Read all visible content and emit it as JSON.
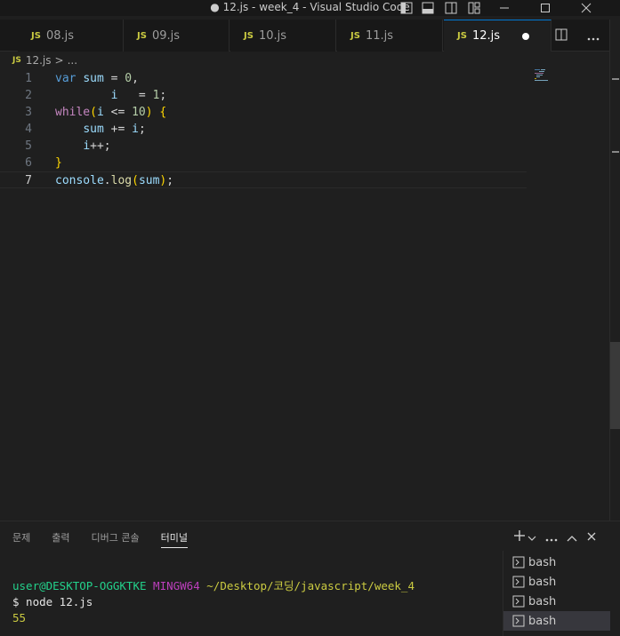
{
  "window": {
    "title": "● 12.js - week_4 - Visual Studio Code"
  },
  "tabs": [
    {
      "badge": "JS",
      "label": "08.js"
    },
    {
      "badge": "JS",
      "label": "09.js"
    },
    {
      "badge": "JS",
      "label": "10.js"
    },
    {
      "badge": "JS",
      "label": "11.js"
    },
    {
      "badge": "JS",
      "label": "12.js"
    }
  ],
  "breadcrumb": {
    "badge": "JS",
    "file": "12.js",
    "sep": ">",
    "more": "..."
  },
  "editor": {
    "line_numbers": [
      "1",
      "2",
      "3",
      "4",
      "5",
      "6",
      "7"
    ],
    "current_line": 7
  },
  "panel": {
    "tabs": [
      "문제",
      "출력",
      "디버그 콘솔",
      "터미널"
    ],
    "active_tab": "터미널",
    "terminal": {
      "user_host": "user@DESKTOP-OGGKTKE",
      "env": "MINGW64",
      "path": "~/Desktop/코딩/javascript/week_4",
      "command": "$ node 12.js",
      "output": "55"
    },
    "terminal_list": [
      "bash",
      "bash",
      "bash",
      "bash"
    ]
  },
  "colors": {
    "accent": "#0078d4",
    "path": "#cbcb41",
    "env": "#bc3fbc",
    "user": "#23d18b"
  }
}
